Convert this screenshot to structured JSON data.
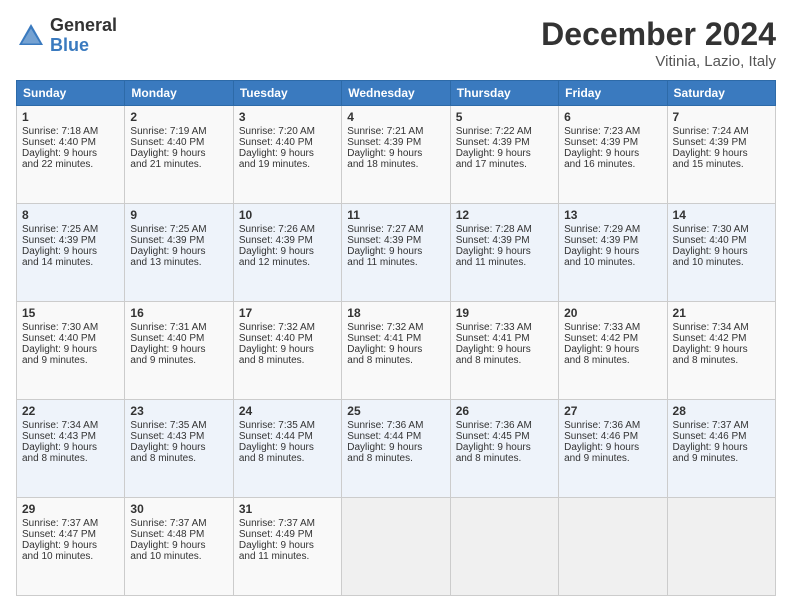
{
  "logo": {
    "general": "General",
    "blue": "Blue"
  },
  "title": "December 2024",
  "subtitle": "Vitinia, Lazio, Italy",
  "headers": [
    "Sunday",
    "Monday",
    "Tuesday",
    "Wednesday",
    "Thursday",
    "Friday",
    "Saturday"
  ],
  "rows": [
    [
      {
        "day": "1",
        "lines": [
          "Sunrise: 7:18 AM",
          "Sunset: 4:40 PM",
          "Daylight: 9 hours",
          "and 22 minutes."
        ]
      },
      {
        "day": "2",
        "lines": [
          "Sunrise: 7:19 AM",
          "Sunset: 4:40 PM",
          "Daylight: 9 hours",
          "and 21 minutes."
        ]
      },
      {
        "day": "3",
        "lines": [
          "Sunrise: 7:20 AM",
          "Sunset: 4:40 PM",
          "Daylight: 9 hours",
          "and 19 minutes."
        ]
      },
      {
        "day": "4",
        "lines": [
          "Sunrise: 7:21 AM",
          "Sunset: 4:39 PM",
          "Daylight: 9 hours",
          "and 18 minutes."
        ]
      },
      {
        "day": "5",
        "lines": [
          "Sunrise: 7:22 AM",
          "Sunset: 4:39 PM",
          "Daylight: 9 hours",
          "and 17 minutes."
        ]
      },
      {
        "day": "6",
        "lines": [
          "Sunrise: 7:23 AM",
          "Sunset: 4:39 PM",
          "Daylight: 9 hours",
          "and 16 minutes."
        ]
      },
      {
        "day": "7",
        "lines": [
          "Sunrise: 7:24 AM",
          "Sunset: 4:39 PM",
          "Daylight: 9 hours",
          "and 15 minutes."
        ]
      }
    ],
    [
      {
        "day": "8",
        "lines": [
          "Sunrise: 7:25 AM",
          "Sunset: 4:39 PM",
          "Daylight: 9 hours",
          "and 14 minutes."
        ]
      },
      {
        "day": "9",
        "lines": [
          "Sunrise: 7:25 AM",
          "Sunset: 4:39 PM",
          "Daylight: 9 hours",
          "and 13 minutes."
        ]
      },
      {
        "day": "10",
        "lines": [
          "Sunrise: 7:26 AM",
          "Sunset: 4:39 PM",
          "Daylight: 9 hours",
          "and 12 minutes."
        ]
      },
      {
        "day": "11",
        "lines": [
          "Sunrise: 7:27 AM",
          "Sunset: 4:39 PM",
          "Daylight: 9 hours",
          "and 11 minutes."
        ]
      },
      {
        "day": "12",
        "lines": [
          "Sunrise: 7:28 AM",
          "Sunset: 4:39 PM",
          "Daylight: 9 hours",
          "and 11 minutes."
        ]
      },
      {
        "day": "13",
        "lines": [
          "Sunrise: 7:29 AM",
          "Sunset: 4:39 PM",
          "Daylight: 9 hours",
          "and 10 minutes."
        ]
      },
      {
        "day": "14",
        "lines": [
          "Sunrise: 7:30 AM",
          "Sunset: 4:40 PM",
          "Daylight: 9 hours",
          "and 10 minutes."
        ]
      }
    ],
    [
      {
        "day": "15",
        "lines": [
          "Sunrise: 7:30 AM",
          "Sunset: 4:40 PM",
          "Daylight: 9 hours",
          "and 9 minutes."
        ]
      },
      {
        "day": "16",
        "lines": [
          "Sunrise: 7:31 AM",
          "Sunset: 4:40 PM",
          "Daylight: 9 hours",
          "and 9 minutes."
        ]
      },
      {
        "day": "17",
        "lines": [
          "Sunrise: 7:32 AM",
          "Sunset: 4:40 PM",
          "Daylight: 9 hours",
          "and 8 minutes."
        ]
      },
      {
        "day": "18",
        "lines": [
          "Sunrise: 7:32 AM",
          "Sunset: 4:41 PM",
          "Daylight: 9 hours",
          "and 8 minutes."
        ]
      },
      {
        "day": "19",
        "lines": [
          "Sunrise: 7:33 AM",
          "Sunset: 4:41 PM",
          "Daylight: 9 hours",
          "and 8 minutes."
        ]
      },
      {
        "day": "20",
        "lines": [
          "Sunrise: 7:33 AM",
          "Sunset: 4:42 PM",
          "Daylight: 9 hours",
          "and 8 minutes."
        ]
      },
      {
        "day": "21",
        "lines": [
          "Sunrise: 7:34 AM",
          "Sunset: 4:42 PM",
          "Daylight: 9 hours",
          "and 8 minutes."
        ]
      }
    ],
    [
      {
        "day": "22",
        "lines": [
          "Sunrise: 7:34 AM",
          "Sunset: 4:43 PM",
          "Daylight: 9 hours",
          "and 8 minutes."
        ]
      },
      {
        "day": "23",
        "lines": [
          "Sunrise: 7:35 AM",
          "Sunset: 4:43 PM",
          "Daylight: 9 hours",
          "and 8 minutes."
        ]
      },
      {
        "day": "24",
        "lines": [
          "Sunrise: 7:35 AM",
          "Sunset: 4:44 PM",
          "Daylight: 9 hours",
          "and 8 minutes."
        ]
      },
      {
        "day": "25",
        "lines": [
          "Sunrise: 7:36 AM",
          "Sunset: 4:44 PM",
          "Daylight: 9 hours",
          "and 8 minutes."
        ]
      },
      {
        "day": "26",
        "lines": [
          "Sunrise: 7:36 AM",
          "Sunset: 4:45 PM",
          "Daylight: 9 hours",
          "and 8 minutes."
        ]
      },
      {
        "day": "27",
        "lines": [
          "Sunrise: 7:36 AM",
          "Sunset: 4:46 PM",
          "Daylight: 9 hours",
          "and 9 minutes."
        ]
      },
      {
        "day": "28",
        "lines": [
          "Sunrise: 7:37 AM",
          "Sunset: 4:46 PM",
          "Daylight: 9 hours",
          "and 9 minutes."
        ]
      }
    ],
    [
      {
        "day": "29",
        "lines": [
          "Sunrise: 7:37 AM",
          "Sunset: 4:47 PM",
          "Daylight: 9 hours",
          "and 10 minutes."
        ]
      },
      {
        "day": "30",
        "lines": [
          "Sunrise: 7:37 AM",
          "Sunset: 4:48 PM",
          "Daylight: 9 hours",
          "and 10 minutes."
        ]
      },
      {
        "day": "31",
        "lines": [
          "Sunrise: 7:37 AM",
          "Sunset: 4:49 PM",
          "Daylight: 9 hours",
          "and 11 minutes."
        ]
      },
      {
        "day": "",
        "lines": []
      },
      {
        "day": "",
        "lines": []
      },
      {
        "day": "",
        "lines": []
      },
      {
        "day": "",
        "lines": []
      }
    ]
  ]
}
